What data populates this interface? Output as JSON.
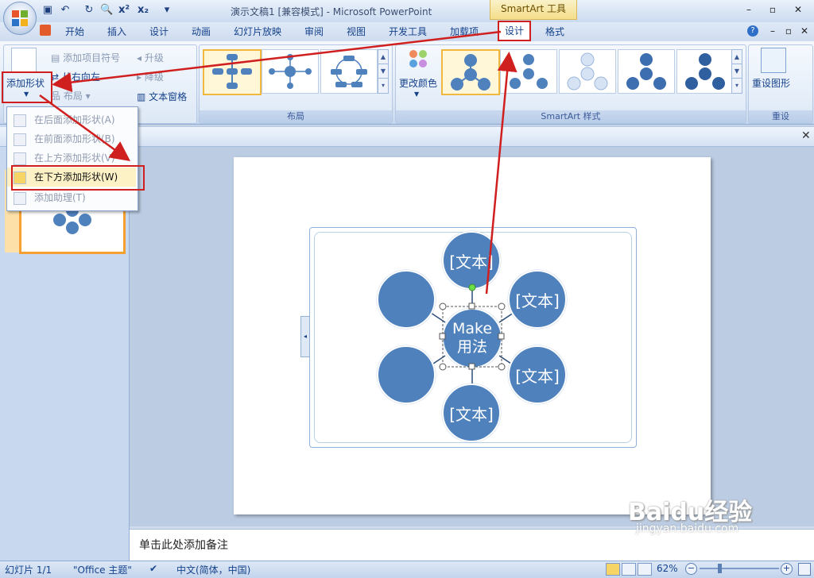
{
  "window": {
    "title": "演示文稿1 [兼容模式] - Microsoft PowerPoint",
    "contextual_tab_group": "SmartArt 工具",
    "controls": [
      "–",
      "▫",
      "✕"
    ]
  },
  "qat": {
    "icons": [
      "save-icon",
      "undo-icon",
      "redo-icon",
      "print-preview-icon",
      "superscript-icon",
      "subscript-icon",
      "customize-icon"
    ],
    "superscript_label": "x²",
    "subscript_label": "x₂"
  },
  "tabs": [
    {
      "label": "开始"
    },
    {
      "label": "插入"
    },
    {
      "label": "设计"
    },
    {
      "label": "动画"
    },
    {
      "label": "幻灯片放映"
    },
    {
      "label": "审阅"
    },
    {
      "label": "视图"
    },
    {
      "label": "开发工具"
    },
    {
      "label": "加载项"
    },
    {
      "label": "设计",
      "active": true
    },
    {
      "label": "格式"
    }
  ],
  "ribbon": {
    "create_graphic": {
      "add_shape": "添加形状",
      "add_bullet": "添加项目符号",
      "right_to_left": "从右向左",
      "layout": "布局",
      "promote": "升级",
      "demote": "降级",
      "text_pane": "文本窗格"
    },
    "layouts_group_label": "布局",
    "change_colors": "更改颜色",
    "styles_group_label": "SmartArt 样式",
    "reset_graphic": "重设图形",
    "reset_group_label": "重设"
  },
  "dropdown": {
    "items": [
      {
        "label": "在后面添加形状(A)",
        "enabled": false
      },
      {
        "label": "在前面添加形状(B)",
        "enabled": false
      },
      {
        "label": "在上方添加形状(V)",
        "enabled": false
      },
      {
        "label": "在下方添加形状(W)",
        "enabled": true
      },
      {
        "label": "添加助理(T)",
        "enabled": false
      }
    ]
  },
  "smartart": {
    "center_text": "Make\n用法",
    "center_line1": "Make",
    "center_line2": "用法",
    "nodes": [
      "[文本]",
      "[文本]",
      "[文本]",
      "[文本]",
      "",
      ""
    ]
  },
  "notes": {
    "placeholder": "单击此处添加备注"
  },
  "statusbar": {
    "slide": "幻灯片 1/1",
    "theme": "\"Office 主题\"",
    "language": "中文(简体，中国)",
    "zoom": "62%"
  },
  "watermark": {
    "brand": "Baidu经验",
    "url": "jingyan.baidu.com"
  },
  "colors": {
    "shape_fill": "#4f81bd",
    "highlight": "#d01f1f",
    "selection": "#f0b83e"
  }
}
